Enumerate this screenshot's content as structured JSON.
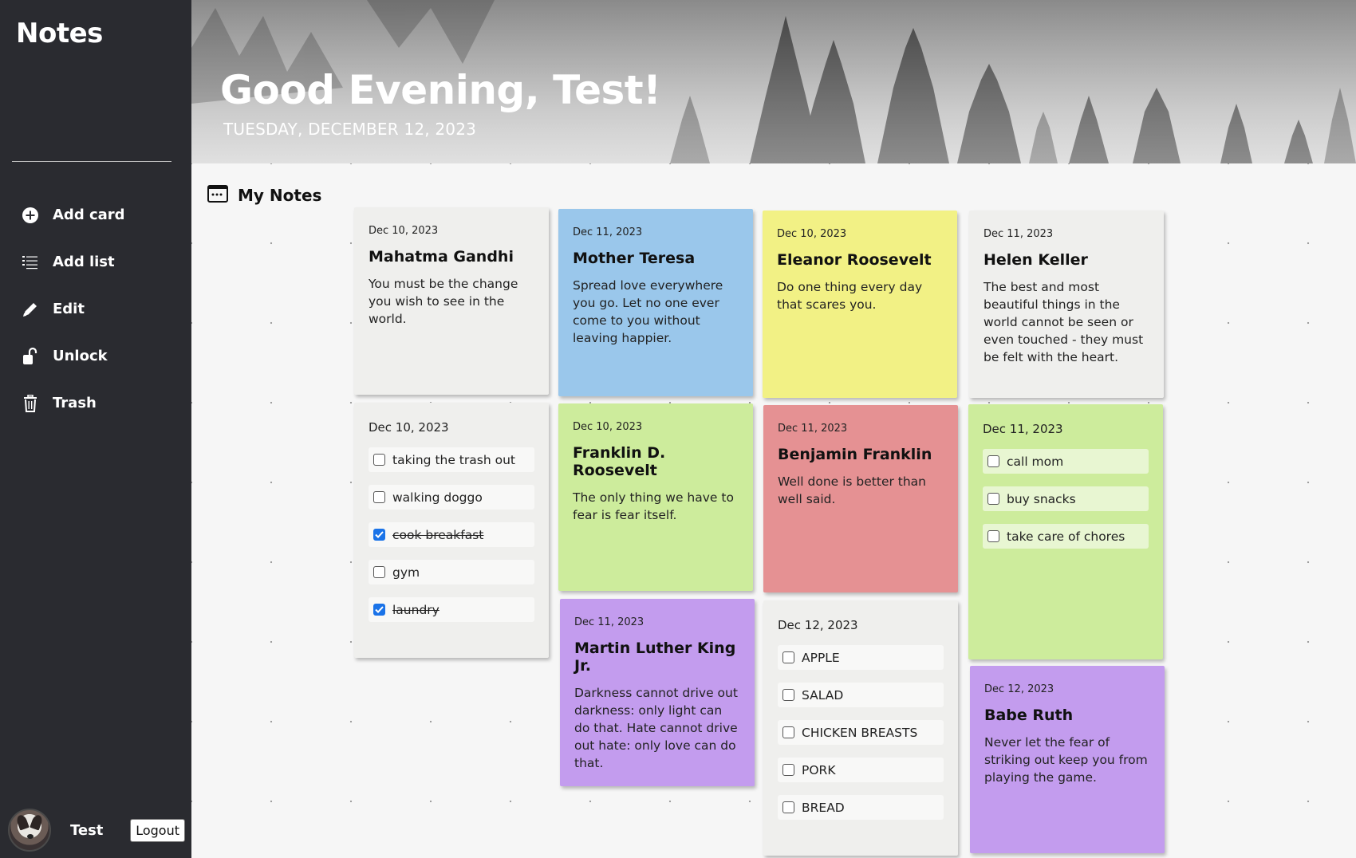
{
  "app": {
    "title": "Notes"
  },
  "sidebar": {
    "items": [
      {
        "label": "Add card",
        "icon": "plus-circle-icon"
      },
      {
        "label": "Add list",
        "icon": "list-icon"
      },
      {
        "label": "Edit",
        "icon": "pencil-icon"
      },
      {
        "label": "Unlock",
        "icon": "unlock-icon"
      },
      {
        "label": "Trash",
        "icon": "trash-icon"
      }
    ],
    "user": {
      "name": "Test",
      "logout_label": "Logout"
    }
  },
  "header": {
    "greeting": "Good Evening, Test!",
    "date": "TUESDAY, DECEMBER 12, 2023"
  },
  "main": {
    "section_title": "My Notes",
    "cards": {
      "gandhi": {
        "date": "Dec 10, 2023",
        "title": "Mahatma Gandhi",
        "body": "You must be the change you wish to see in the world.",
        "color": "#efefed"
      },
      "teresa": {
        "date": "Dec 11, 2023",
        "title": "Mother Teresa",
        "body": "Spread love everywhere you go. Let no one ever come to you without leaving happier.",
        "color": "#9ac7eb"
      },
      "eleanor": {
        "date": "Dec 10, 2023",
        "title": "Eleanor Roosevelt",
        "body": "Do one thing every day that scares you.",
        "color": "#f2f185"
      },
      "keller": {
        "date": "Dec 11, 2023",
        "title": "Helen Keller",
        "body": "The best and most beautiful things in the world cannot be seen or even touched - they must be felt with the heart.",
        "color": "#efefed"
      },
      "fdr": {
        "date": "Dec 10, 2023",
        "title": "Franklin D. Roosevelt",
        "body": "The only thing we have to fear is fear itself.",
        "color": "#cdec9c"
      },
      "franklin": {
        "date": "Dec 11, 2023",
        "title": "Benjamin Franklin",
        "body": "Well done is better than well said.",
        "color": "#e59193"
      },
      "mlk": {
        "date": "Dec 11, 2023",
        "title": "Martin Luther King Jr.",
        "body": "Darkness cannot drive out darkness: only light can do that. Hate cannot drive out hate: only love can do that.",
        "color": "#c39cee"
      },
      "ruth": {
        "date": "Dec 12, 2023",
        "title": "Babe Ruth",
        "body": "Never let the fear of striking out keep you from playing the game.",
        "color": "#c39cee"
      }
    },
    "lists": {
      "chores": {
        "date": "Dec 10, 2023",
        "items": [
          {
            "text": "taking the trash out",
            "checked": false
          },
          {
            "text": "walking doggo",
            "checked": false
          },
          {
            "text": "cook breakfast",
            "checked": true
          },
          {
            "text": "gym",
            "checked": false
          },
          {
            "text": "laundry",
            "checked": true
          }
        ]
      },
      "todos": {
        "date": "Dec 11, 2023",
        "items": [
          {
            "text": "call mom",
            "checked": false
          },
          {
            "text": "buy snacks",
            "checked": false
          },
          {
            "text": "take care of chores",
            "checked": false
          }
        ]
      },
      "groceries": {
        "date": "Dec 12, 2023",
        "items": [
          {
            "text": "APPLE",
            "checked": false
          },
          {
            "text": "SALAD",
            "checked": false
          },
          {
            "text": "CHICKEN BREASTS",
            "checked": false
          },
          {
            "text": "PORK",
            "checked": false
          },
          {
            "text": "BREAD",
            "checked": false
          }
        ]
      }
    }
  }
}
